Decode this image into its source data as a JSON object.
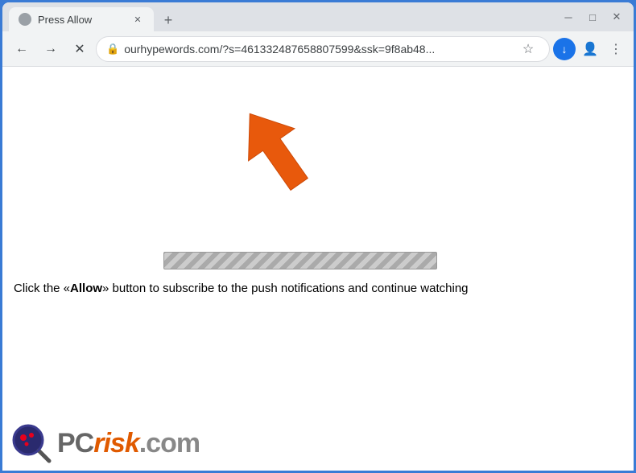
{
  "window": {
    "title": "Press Allow",
    "url": "ourhypewords.com/?s=461332487658807599&ssk=9f8ab48...",
    "url_display": "ourhypewords.com/?s=461332487658807599&ssk=9f8ab48..."
  },
  "toolbar": {
    "back_label": "←",
    "forward_label": "→",
    "close_label": "✕",
    "new_tab_label": "+",
    "star_label": "☆",
    "minimize_label": "─",
    "maximize_label": "□",
    "window_close_label": "✕"
  },
  "page": {
    "message": "Click the «Allow» button to subscribe to the push notifications and continue watching",
    "message_prefix": "Click the «",
    "message_allow": "Allow",
    "message_suffix": "» button to subscribe to the push notifications and continue watching"
  },
  "branding": {
    "pc_text": "PC",
    "risk_text": "risk",
    "dot_com": ".com"
  }
}
